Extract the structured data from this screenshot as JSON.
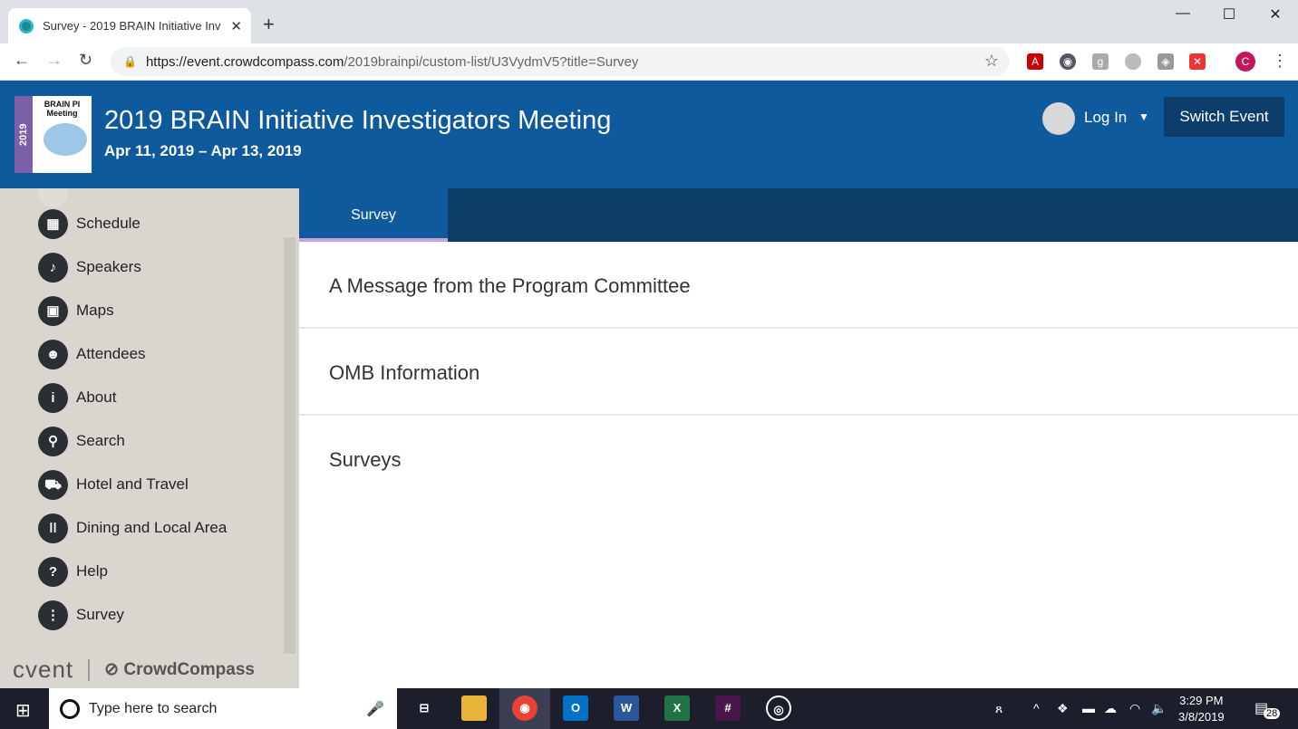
{
  "browser": {
    "tab_title": "Survey - 2019 BRAIN Initiative Inv",
    "new_tab": "+",
    "url_host": "https://event.crowdcompass.com",
    "url_path": "/2019brainpi/custom-list/U3VydmV5?title=Survey",
    "profile_initial": "C"
  },
  "header": {
    "logo_year": "2019",
    "logo_text": "BRAIN PI Meeting",
    "title": "2019 BRAIN Initiative Investigators Meeting",
    "dates": "Apr 11, 2019 – Apr 13, 2019",
    "login": "Log In",
    "switch_event": "Switch Event",
    "colors": {
      "header_bg": "#0f5a9c",
      "button_bg": "#0d3d6b"
    }
  },
  "sidebar": {
    "items": [
      {
        "label": "Schedule",
        "icon": "calendar-icon"
      },
      {
        "label": "Speakers",
        "icon": "microphone-icon"
      },
      {
        "label": "Maps",
        "icon": "map-icon"
      },
      {
        "label": "Attendees",
        "icon": "people-icon"
      },
      {
        "label": "About",
        "icon": "info-icon"
      },
      {
        "label": "Search",
        "icon": "magnifier-icon"
      },
      {
        "label": "Hotel and Travel",
        "icon": "car-icon"
      },
      {
        "label": "Dining and Local Area",
        "icon": "fork-knife-icon"
      },
      {
        "label": "Help",
        "icon": "question-icon"
      },
      {
        "label": "Survey",
        "icon": "survey-icon"
      }
    ],
    "footer_cvent": "cvent",
    "footer_cc": "CrowdCompass"
  },
  "content": {
    "tab": "Survey",
    "rows": [
      "A Message from the Program Committee",
      "OMB Information",
      "Surveys"
    ]
  },
  "taskbar": {
    "search_placeholder": "Type here to search",
    "time": "3:29 PM",
    "date": "3/8/2019",
    "notifications": "28"
  }
}
